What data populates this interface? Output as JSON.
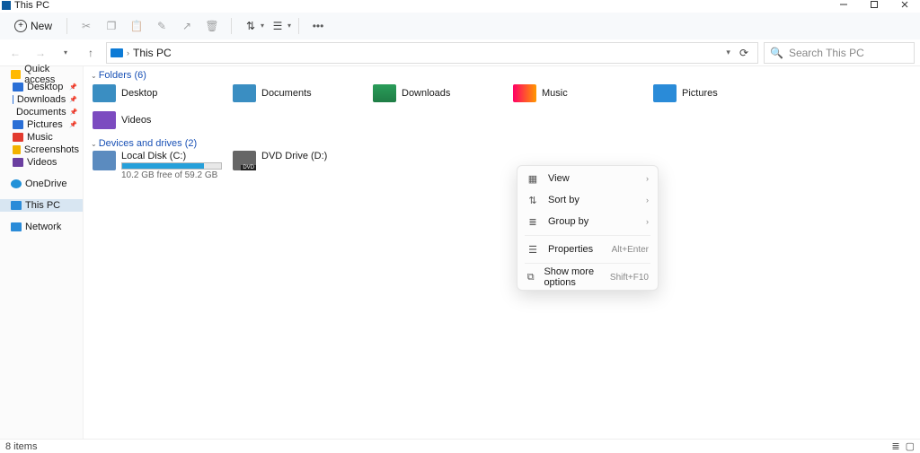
{
  "window": {
    "title": "This PC"
  },
  "toolbar": {
    "new_label": "New"
  },
  "address": {
    "location": "This PC"
  },
  "search": {
    "placeholder": "Search This PC"
  },
  "sidebar": {
    "quick_access": "Quick access",
    "items": [
      "Desktop",
      "Downloads",
      "Documents",
      "Pictures",
      "Music",
      "Screenshots",
      "Videos"
    ],
    "onedrive": "OneDrive",
    "thispc": "This PC",
    "network": "Network"
  },
  "sections": {
    "folders_header": "Folders (6)",
    "drives_header": "Devices and drives (2)"
  },
  "folders": [
    "Desktop",
    "Documents",
    "Downloads",
    "Music",
    "Pictures",
    "Videos"
  ],
  "drives": [
    {
      "name": "Local Disk (C:)",
      "free_text": "10.2 GB free of 59.2 GB",
      "fill_pct": 83
    },
    {
      "name": "DVD Drive (D:)"
    }
  ],
  "context_menu": {
    "view": "View",
    "sort": "Sort by",
    "group": "Group by",
    "properties": "Properties",
    "properties_shortcut": "Alt+Enter",
    "more": "Show more options",
    "more_shortcut": "Shift+F10"
  },
  "status": {
    "items": "8 items"
  }
}
